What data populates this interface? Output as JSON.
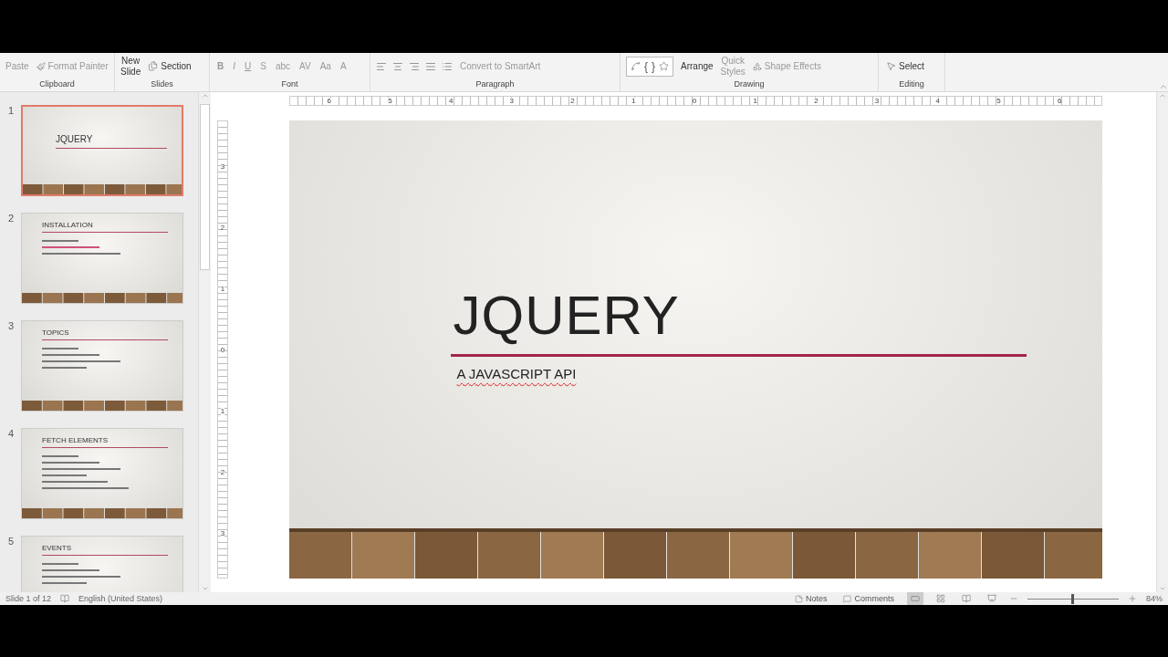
{
  "ribbon": {
    "groups": [
      {
        "kind": "clipboard",
        "label": "Clipboard",
        "paste": "Paste",
        "format_painter": "Format Painter"
      },
      {
        "kind": "slides",
        "label": "Slides",
        "new_slide": [
          "New",
          "Slide"
        ],
        "section": "Section"
      },
      {
        "kind": "font",
        "label": "Font",
        "buttons": [
          "B",
          "I",
          "U",
          "S",
          "abc",
          "AV",
          "Aa",
          "A"
        ]
      },
      {
        "kind": "paragraph",
        "label": "Paragraph",
        "smartart": "Convert to SmartArt"
      },
      {
        "kind": "drawing",
        "label": "Drawing",
        "glyphs": [
          "{",
          "}"
        ],
        "arrange": "Arrange",
        "quick_styles": [
          "Quick",
          "Styles"
        ],
        "shape_effects": "Shape Effects"
      },
      {
        "kind": "editing",
        "label": "Editing",
        "select": "Select"
      }
    ]
  },
  "thumbnails": [
    {
      "number": "1",
      "title": "JQUERY",
      "selected": true
    },
    {
      "number": "2",
      "title": "INSTALLATION",
      "selected": false
    },
    {
      "number": "3",
      "title": "TOPICS",
      "selected": false
    },
    {
      "number": "4",
      "title": "FETCH ELEMENTS",
      "selected": false
    },
    {
      "number": "5",
      "title": "EVENTS",
      "selected": false
    }
  ],
  "ruler": {
    "horizontal": [
      "6",
      "5",
      "4",
      "3",
      "2",
      "1",
      "0",
      "1",
      "2",
      "3",
      "4",
      "5",
      "6"
    ],
    "vertical": [
      "3",
      "2",
      "1",
      "0",
      "1",
      "2",
      "3"
    ]
  },
  "slide": {
    "title": "JQUERY",
    "subtitle": "A JAVASCRIPT API"
  },
  "status_bar": {
    "slide_count": "Slide 1 of 12",
    "language": "English (United States)",
    "notes": "Notes",
    "comments": "Comments",
    "zoom": "84%",
    "zoom_slider": {
      "level": 0.48
    }
  }
}
